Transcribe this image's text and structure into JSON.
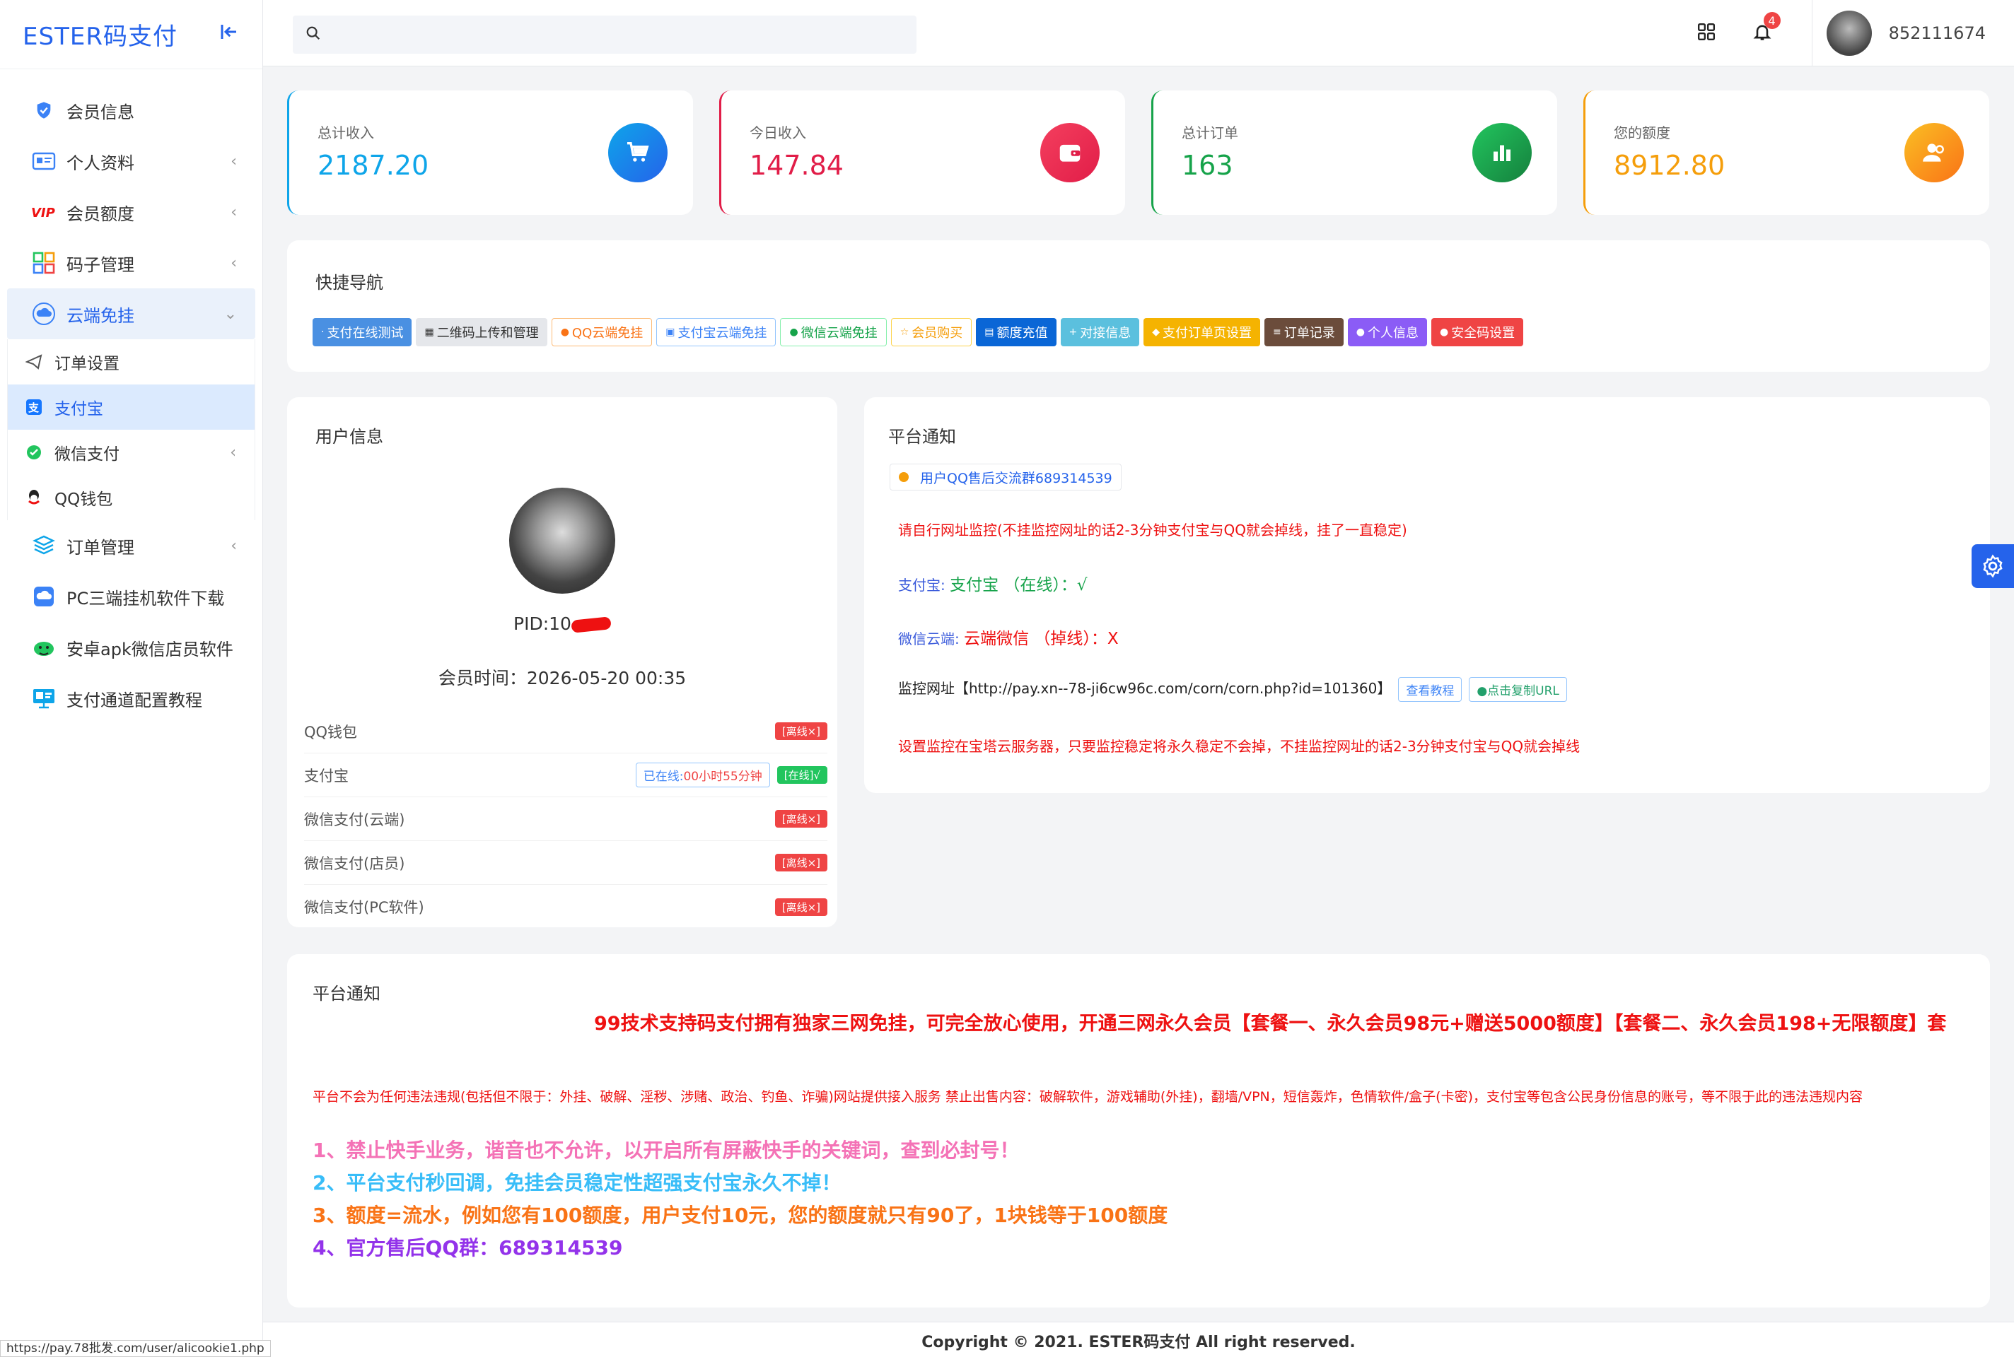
{
  "app": {
    "logo": "ESTER码支付"
  },
  "colors": {
    "primary": "#2563eb",
    "danger": "#ef4444",
    "success": "#22c55e"
  },
  "sidebar": {
    "items": [
      {
        "label": "会员信息",
        "icon": "shield-icon"
      },
      {
        "label": "个人资料",
        "icon": "id-card-icon"
      },
      {
        "label": "会员额度",
        "icon": "vip-icon"
      },
      {
        "label": "码子管理",
        "icon": "grid-icon"
      },
      {
        "label": "云端免挂",
        "icon": "cloud-icon"
      },
      {
        "label": "订单管理",
        "icon": "layers-icon"
      },
      {
        "label": "PC三端挂机软件下载",
        "icon": "cloud-download-icon"
      },
      {
        "label": "安卓apk微信店员软件",
        "icon": "android-icon"
      },
      {
        "label": "支付通道配置教程",
        "icon": "monitor-icon"
      }
    ],
    "sub_items": [
      {
        "label": "订单设置",
        "icon": "send-icon"
      },
      {
        "label": "支付宝",
        "icon": "alipay-icon"
      },
      {
        "label": "微信支付",
        "icon": "wechat-icon"
      },
      {
        "label": "QQ钱包",
        "icon": "qq-icon"
      }
    ]
  },
  "topbar": {
    "username": "852111674",
    "notification_count": "4"
  },
  "stats": [
    {
      "label": "总计收入",
      "value": "2187.20",
      "color": "#0ea5e9"
    },
    {
      "label": "今日收入",
      "value": "147.84",
      "color": "#e11d48"
    },
    {
      "label": "总计订单",
      "value": "163",
      "color": "#16a34a"
    },
    {
      "label": "您的额度",
      "value": "8912.80",
      "color": "#f59e0b"
    }
  ],
  "quick_nav": {
    "title": "快捷导航",
    "buttons": [
      "支付在线测试",
      "二维码上传和管理",
      "QQ云端免挂",
      "支付宝云端免挂",
      "微信云端免挂",
      "会员购买",
      "额度充值",
      "对接信息",
      "支付订单页设置",
      "订单记录",
      "个人信息",
      "安全码设置"
    ]
  },
  "user_info": {
    "title": "用户信息",
    "pid_label": "PID:10",
    "member_time": "会员时间：2026-05-20 00:35",
    "channels": [
      {
        "name": "QQ钱包",
        "status": "[离线×]"
      },
      {
        "name": "支付宝",
        "online_prefix": "已在线:",
        "online_time": "00小时55分钟",
        "status": "[在线]√"
      },
      {
        "name": "微信支付(云端)",
        "status": "[离线×]"
      },
      {
        "name": "微信支付(店员)",
        "status": "[离线×]"
      },
      {
        "name": "微信支付(PC软件)",
        "status": "[离线×]"
      }
    ]
  },
  "platform_notice": {
    "title": "平台通知",
    "group_chip": "用户QQ售后交流群689314539",
    "line1": "请自行网址监控(不挂监控网址的话2-3分钟支付宝与QQ就会掉线，挂了一直稳定)",
    "alipay_label": "支付宝:",
    "alipay_status": "支付宝 （在线）：√",
    "wechat_label": "微信云端:",
    "wechat_status": "云端微信 （掉线）：X",
    "monitor_label": "监控网址【http://pay.xn--78-ji6cw96c.com/corn/corn.php?id=101360】",
    "btn_tutorial": "查看教程",
    "btn_copy": "点击复制URL",
    "line_last": "设置监控在宝塔云服务器，只要监控稳定将永久稳定不会掉，不挂监控网址的话2-3分钟支付宝与QQ就会掉线"
  },
  "bottom_notice": {
    "title": "平台通知",
    "marquee": "99技术支持码支付拥有独家三网免挂，可完全放心使用，开通三网永久会员【套餐一、永久会员98元+赠送5000额度】【套餐二、永久会员198+无限额度】套",
    "disclaimer": "平台不会为任何违法违规(包括但不限于：外挂、破解、淫秽、涉赌、政治、钓鱼、诈骗)网站提供接入服务 禁止出售内容：破解软件，游戏辅助(外挂)，翻墙/VPN，短信轰炸，色情软件/盒子(卡密)，支付宝等包含公民身份信息的账号，等不限于此的违法违规内容",
    "rules": [
      {
        "text": "1、禁止快手业务，谐音也不允许，以开启所有屏蔽快手的关键词，查到必封号！",
        "color": "#f472b6"
      },
      {
        "text": "2、平台支付秒回调，免挂会员稳定性超强支付宝永久不掉！",
        "color": "#38bdf8"
      },
      {
        "text": "3、额度=流水，例如您有100额度，用户支付10元，您的额度就只有90了，1块钱等于100额度",
        "color": "#f97316"
      },
      {
        "text": "4、官方售后QQ群：689314539",
        "color": "#9333ea"
      }
    ]
  },
  "footer": {
    "copyright": "Copyright © 2021. ESTER码支付 All right reserved."
  },
  "statusbar": {
    "url": "https://pay.78批发.com/user/alicookie1.php"
  }
}
